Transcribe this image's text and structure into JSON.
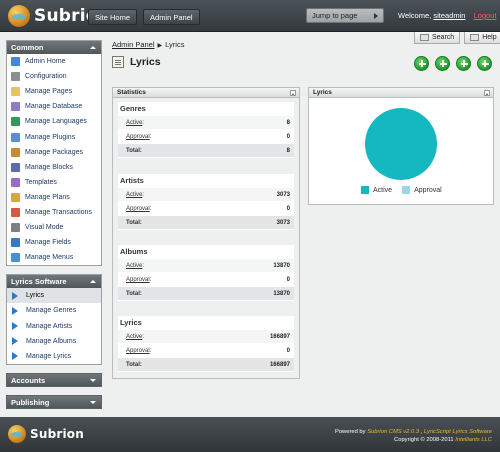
{
  "header": {
    "brand": "Subrion",
    "nav": [
      "Site Home",
      "Admin Panel"
    ],
    "jump_label": "Jump to page",
    "welcome": "Welcome,",
    "user": "siteadmin",
    "logout": "Logout"
  },
  "sidebar": {
    "common_title": "Common",
    "common_items": [
      {
        "label": "Admin Home",
        "icon": "house-icon",
        "color": "#3c8ad8"
      },
      {
        "label": "Configuration",
        "icon": "wrench-icon",
        "color": "#8a8f92"
      },
      {
        "label": "Manage Pages",
        "icon": "pages-icon",
        "color": "#e7c45a"
      },
      {
        "label": "Manage Database",
        "icon": "database-icon",
        "color": "#8e7cc3"
      },
      {
        "label": "Manage Languages",
        "icon": "globe-icon",
        "color": "#2f9a5b"
      },
      {
        "label": "Manage Plugins",
        "icon": "plugin-icon",
        "color": "#5d8fd0"
      },
      {
        "label": "Manage Packages",
        "icon": "package-icon",
        "color": "#c98a3a"
      },
      {
        "label": "Manage Blocks",
        "icon": "blocks-icon",
        "color": "#5a6bb0"
      },
      {
        "label": "Templates",
        "icon": "template-icon",
        "color": "#9b6ac4"
      },
      {
        "label": "Manage Plans",
        "icon": "plans-icon",
        "color": "#d5a83a"
      },
      {
        "label": "Manage Transactions",
        "icon": "transactions-icon",
        "color": "#d35a3a"
      },
      {
        "label": "Visual Mode",
        "icon": "visual-mode-icon",
        "color": "#7a7f82"
      },
      {
        "label": "Manage Fields",
        "icon": "fields-icon",
        "color": "#3a78c4"
      },
      {
        "label": "Manage Menus",
        "icon": "menus-icon",
        "color": "#4a8fd0"
      }
    ],
    "lyrics_title": "Lyrics Software",
    "lyrics_items": [
      "Lyrics",
      "Manage Genres",
      "Manage Artists",
      "Manage Albums",
      "Manage Lyrics"
    ],
    "accounts_title": "Accounts",
    "publishing_title": "Publishing"
  },
  "breadcrumb": {
    "parent": "Admin Panel",
    "current": "Lyrics"
  },
  "top_buttons": {
    "search": "Search",
    "help": "Help"
  },
  "page_title": "Lyrics",
  "statistics": {
    "title": "Statistics",
    "sections": [
      {
        "title": "Genres",
        "active_label": "Active",
        "active": "8",
        "approval_label": "Approval",
        "approval": "0",
        "total_label": "Total:",
        "total": "8"
      },
      {
        "title": "Artists",
        "active_label": "Active",
        "active": "3073",
        "approval_label": "Approval",
        "approval": "0",
        "total_label": "Total:",
        "total": "3073"
      },
      {
        "title": "Albums",
        "active_label": "Active",
        "active": "13870",
        "approval_label": "Approval",
        "approval": "0",
        "total_label": "Total:",
        "total": "13870"
      },
      {
        "title": "Lyrics",
        "active_label": "Active",
        "active": "166897",
        "approval_label": "Approval",
        "approval": "0",
        "total_label": "Total:",
        "total": "166897"
      }
    ]
  },
  "lyrics_chart": {
    "title": "Lyrics",
    "legend": [
      "Active",
      "Approval"
    ],
    "colors": {
      "active": "#13b8c0",
      "approval": "#9fd4e6"
    }
  },
  "chart_data": {
    "type": "pie",
    "categories": [
      "Active",
      "Approval"
    ],
    "values": [
      166897,
      0
    ]
  },
  "footer": {
    "brand": "Subrion",
    "powered_by": "Powered by",
    "cms": "Subrion CMS v2.0.3",
    "product": "LyricScript Lyrics Software",
    "copyright": "Copyright © 2008-2011",
    "company": "Intelliants LLC"
  }
}
